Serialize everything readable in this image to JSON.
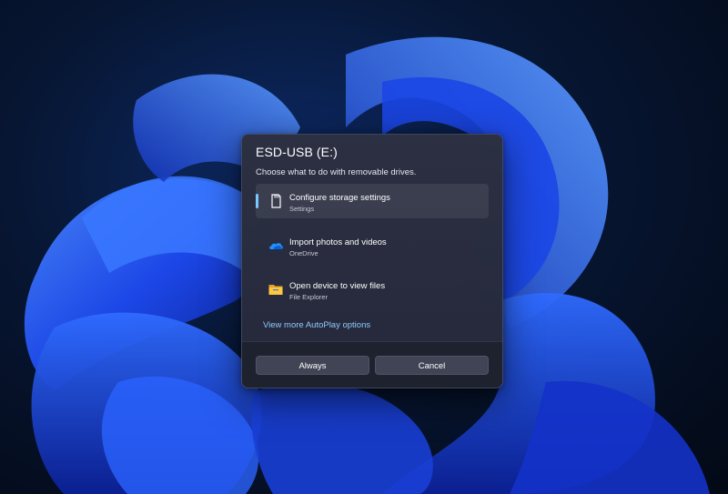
{
  "dialog": {
    "title": "ESD-USB (E:)",
    "subtitle": "Choose what to do with removable drives.",
    "options": [
      {
        "title": "Configure storage settings",
        "subtitle": "Settings",
        "icon": "sd-card-icon",
        "selected": true
      },
      {
        "title": "Import photos and videos",
        "subtitle": "OneDrive",
        "icon": "onedrive-cloud-icon",
        "selected": false
      },
      {
        "title": "Open device to view files",
        "subtitle": "File Explorer",
        "icon": "folder-icon",
        "selected": false
      }
    ],
    "more_link": "View more AutoPlay options",
    "buttons": {
      "always": "Always",
      "cancel": "Cancel"
    }
  },
  "colors": {
    "accent_indicator": "#7cc7ff",
    "link": "#8fc9ff",
    "dialog_bg": "#2c3042",
    "wallpaper_blue": "#1f4fff"
  }
}
